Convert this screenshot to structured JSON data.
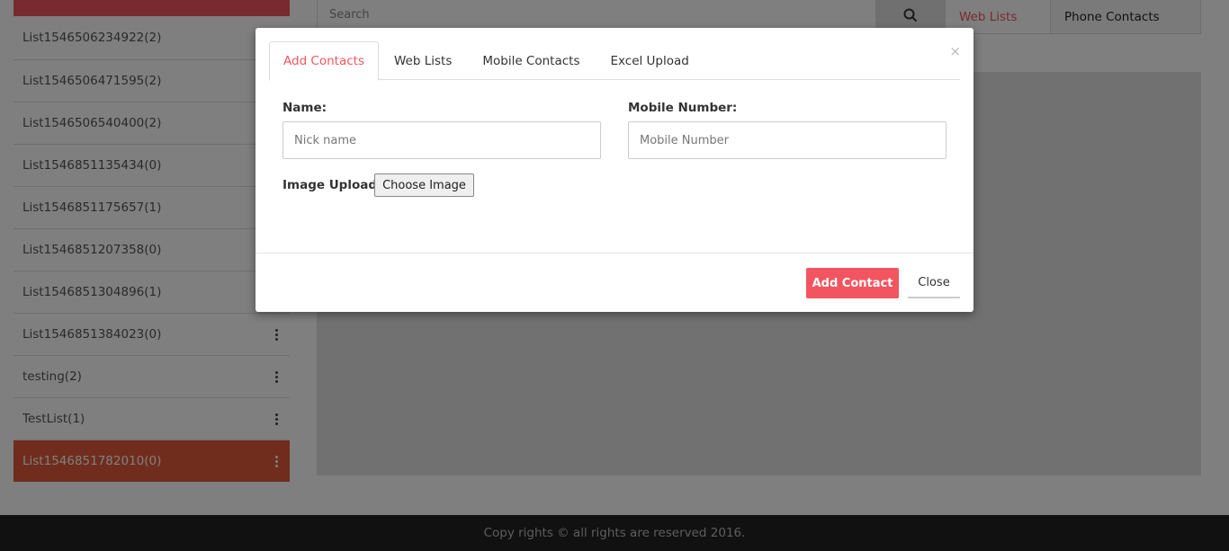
{
  "sidebar": {
    "items": [
      {
        "label": "List1546506234922(2)",
        "has_menu": false
      },
      {
        "label": "List1546506471595(2)",
        "has_menu": false
      },
      {
        "label": "List1546506540400(2)",
        "has_menu": false
      },
      {
        "label": "List1546851135434(0)",
        "has_menu": false
      },
      {
        "label": "List1546851175657(1)",
        "has_menu": false
      },
      {
        "label": "List1546851207358(0)",
        "has_menu": false
      },
      {
        "label": "List1546851304896(1)",
        "has_menu": false
      },
      {
        "label": "List1546851384023(0)",
        "has_menu": true
      },
      {
        "label": "testing(2)",
        "has_menu": true
      },
      {
        "label": "TestList(1)",
        "has_menu": true
      },
      {
        "label": "List1546851782010(0)",
        "has_menu": true,
        "active": true
      }
    ]
  },
  "header": {
    "search_placeholder": "Search",
    "tabs": {
      "web_lists": "Web Lists",
      "phone_contacts": "Phone Contacts"
    }
  },
  "footer": {
    "text": "Copy rights © all rights are reserved 2016."
  },
  "modal": {
    "close_x": "×",
    "tabs": [
      "Add Contacts",
      "Web Lists",
      "Mobile Contacts",
      "Excel Upload"
    ],
    "active_tab": "Add Contacts",
    "name_label": "Name:",
    "name_placeholder": "Nick name",
    "mobile_label": "Mobile Number:",
    "mobile_placeholder": "Mobile Number",
    "image_label": "Image Upload:",
    "choose_image": "Choose Image",
    "add_button": "Add Contact",
    "close_button": "Close"
  },
  "colors": {
    "accent": "#f2555f",
    "active_item": "#e05b3a",
    "footer": "#222222"
  }
}
